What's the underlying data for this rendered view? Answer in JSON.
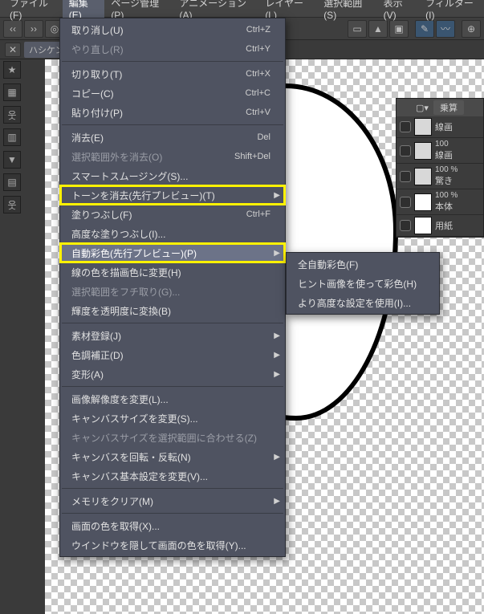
{
  "menubar": {
    "items": [
      "ファイル(F)",
      "編集(E)",
      "ページ管理(P)",
      "アニメーション(A)",
      "レイヤー(L)",
      "選択範囲(S)",
      "表示(V)",
      "フィルター(I)"
    ],
    "active_index": 1
  },
  "subbar": {
    "label": "ハシケン"
  },
  "edit_menu": {
    "items": [
      {
        "label": "取り消し(U)",
        "shortcut": "Ctrl+Z"
      },
      {
        "label": "やり直し(R)",
        "shortcut": "Ctrl+Y",
        "disabled": true
      },
      {
        "sep": true
      },
      {
        "label": "切り取り(T)",
        "shortcut": "Ctrl+X"
      },
      {
        "label": "コピー(C)",
        "shortcut": "Ctrl+C"
      },
      {
        "label": "貼り付け(P)",
        "shortcut": "Ctrl+V"
      },
      {
        "sep": true
      },
      {
        "label": "消去(E)",
        "shortcut": "Del"
      },
      {
        "label": "選択範囲外を消去(O)",
        "shortcut": "Shift+Del",
        "disabled": true
      },
      {
        "label": "スマートスムージング(S)..."
      },
      {
        "label": "トーンを消去(先行プレビュー)(T)",
        "arrow": true,
        "boxed": true
      },
      {
        "label": "塗りつぶし(F)",
        "shortcut": "Ctrl+F"
      },
      {
        "label": "高度な塗りつぶし(I)..."
      },
      {
        "label": "自動彩色(先行プレビュー)(P)",
        "arrow": true,
        "boxed": true,
        "hover": true
      },
      {
        "label": "線の色を描画色に変更(H)"
      },
      {
        "label": "選択範囲をフチ取り(G)...",
        "disabled": true
      },
      {
        "label": "輝度を透明度に変換(B)"
      },
      {
        "sep": true
      },
      {
        "label": "素材登録(J)",
        "arrow": true
      },
      {
        "label": "色調補正(D)",
        "arrow": true
      },
      {
        "label": "変形(A)",
        "arrow": true
      },
      {
        "sep": true
      },
      {
        "label": "画像解像度を変更(L)..."
      },
      {
        "label": "キャンバスサイズを変更(S)..."
      },
      {
        "label": "キャンバスサイズを選択範囲に合わせる(Z)",
        "disabled": true
      },
      {
        "label": "キャンバスを回転・反転(N)",
        "arrow": true
      },
      {
        "label": "キャンバス基本設定を変更(V)..."
      },
      {
        "sep": true
      },
      {
        "label": "メモリをクリア(M)",
        "arrow": true
      },
      {
        "sep": true
      },
      {
        "label": "画面の色を取得(X)..."
      },
      {
        "label": "ウインドウを隠して画面の色を取得(Y)..."
      }
    ]
  },
  "submenu": {
    "items": [
      {
        "label": "全自動彩色(F)"
      },
      {
        "label": "ヒント画像を使って彩色(H)"
      },
      {
        "label": "より高度な設定を使用(I)..."
      }
    ]
  },
  "layers": {
    "blend_mode": "乗算",
    "rows": [
      {
        "name": "線画",
        "opacity": ""
      },
      {
        "name": "線画",
        "opacity": "100"
      },
      {
        "name": "驚き",
        "opacity": "100 %"
      },
      {
        "name": "本体",
        "opacity": "100 %"
      },
      {
        "name": "用紙",
        "opacity": ""
      }
    ]
  }
}
